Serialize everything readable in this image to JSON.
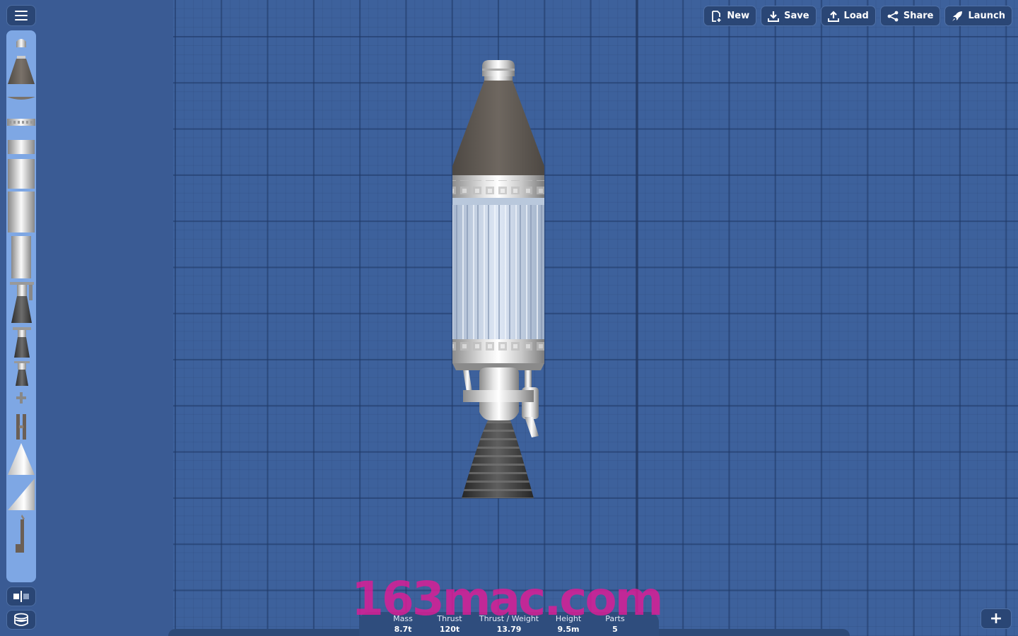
{
  "toolbar": {
    "buttons": [
      {
        "id": "new",
        "label": "New",
        "icon": "new-file-icon"
      },
      {
        "id": "save",
        "label": "Save",
        "icon": "download-icon"
      },
      {
        "id": "load",
        "label": "Load",
        "icon": "upload-icon"
      },
      {
        "id": "share",
        "label": "Share",
        "icon": "share-icon"
      },
      {
        "id": "launch",
        "label": "Launch",
        "icon": "rocket-icon"
      }
    ]
  },
  "sidebar": {
    "menu_icon": "hamburger-menu-icon",
    "parts": [
      "probe-pod",
      "nose-cone",
      "heat-shield",
      "separator",
      "fuel-tank-small",
      "fuel-tank-medium",
      "fuel-tank-large",
      "fuel-tank-xl",
      "engine-large",
      "engine-medium",
      "engine-small",
      "rcs-thruster",
      "landing-leg",
      "fairing-cone",
      "fairing-side",
      "parachute-strut"
    ],
    "symmetry_icon": "symmetry-icon",
    "layers_icon": "layers-icon"
  },
  "stats": {
    "mass": {
      "label": "Mass",
      "value": "8.7t"
    },
    "thrust": {
      "label": "Thrust",
      "value": "120t"
    },
    "thrust_weight": {
      "label": "Thrust / Weight",
      "value": "13.79"
    },
    "height": {
      "label": "Height",
      "value": "9.5m"
    },
    "parts": {
      "label": "Parts",
      "value": "5"
    }
  },
  "watermark": "163mac.com",
  "add_button": "+",
  "colors": {
    "background": "#3a5b94",
    "grid": "#3d619c",
    "button": "#2a4675",
    "parts_panel": "#7ea7e4",
    "watermark": "#de1c96"
  }
}
